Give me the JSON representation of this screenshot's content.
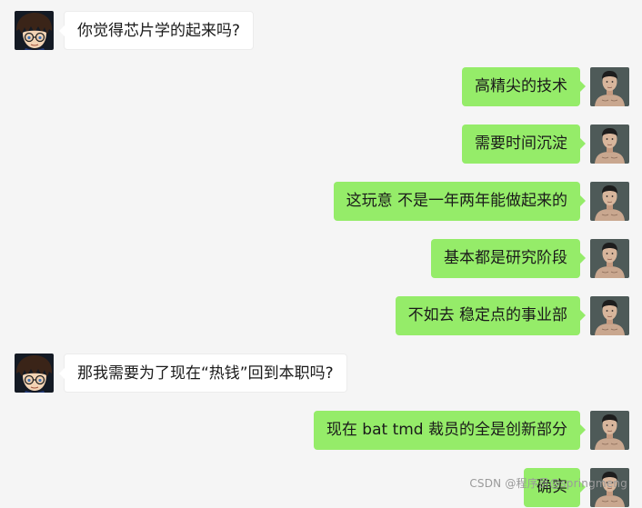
{
  "messages": [
    {
      "side": "left",
      "avatar": "conan-avatar",
      "text": "你觉得芯片学的起来吗?"
    },
    {
      "side": "right",
      "avatar": "man-avatar",
      "text": "高精尖的技术"
    },
    {
      "side": "right",
      "avatar": "man-avatar",
      "text": "需要时间沉淀"
    },
    {
      "side": "right",
      "avatar": "man-avatar",
      "text": "这玩意 不是一年两年能做起来的"
    },
    {
      "side": "right",
      "avatar": "man-avatar",
      "text": "基本都是研究阶段"
    },
    {
      "side": "right",
      "avatar": "man-avatar",
      "text": "不如去  稳定点的事业部"
    },
    {
      "side": "left",
      "avatar": "conan-avatar",
      "text": "那我需要为了现在“热钱”回到本职吗?"
    },
    {
      "side": "right",
      "avatar": "man-avatar",
      "text": "现在  bat  tmd  裁员的全是创新部分"
    },
    {
      "side": "right",
      "avatar": "man-avatar",
      "text": "确实"
    }
  ],
  "watermark": "CSDN @程序员@springmeng",
  "colors": {
    "background": "#f5f5f5",
    "self_bubble": "#95ec69",
    "other_bubble": "#ffffff"
  }
}
